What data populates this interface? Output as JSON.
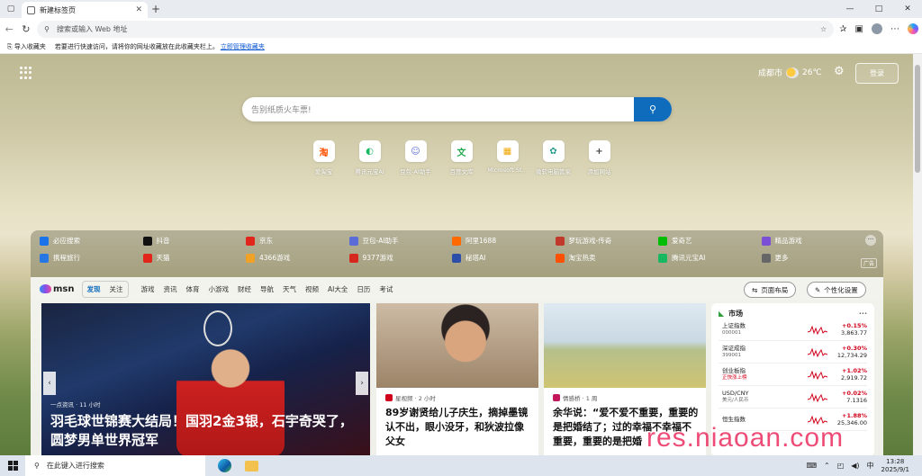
{
  "browser": {
    "tab_title": "新建标签页",
    "new_tab_symbol": "+",
    "address_placeholder": "搜索或输入 Web 地址",
    "window_controls": [
      "—",
      "□",
      "✕"
    ]
  },
  "favorites_bar": {
    "import_label": "导入收藏夹",
    "message": "若要进行快速访问，请将你的网址收藏放在此收藏夹栏上。",
    "manage_link": "立即管理收藏夹"
  },
  "header": {
    "city": "成都市",
    "temperature": "26℃",
    "login_label": "登录"
  },
  "search": {
    "placeholder": "告别纸质火车票!"
  },
  "quick_links": [
    {
      "label": "爱淘宝",
      "icon": "taobao-icon",
      "glyph": "淘",
      "color": "#ff5000"
    },
    {
      "label": "腾讯元宝AI",
      "icon": "yuanbao-icon",
      "glyph": "◐",
      "color": "#17b860"
    },
    {
      "label": "豆包-AI助手",
      "icon": "doubao-icon",
      "glyph": "☺",
      "color": "#5a6cd8"
    },
    {
      "label": "百度文库",
      "icon": "wenku-icon",
      "glyph": "文",
      "color": "#22a94e"
    },
    {
      "label": "Microsoft St...",
      "icon": "store-icon",
      "glyph": "▦",
      "color": "#f0a500"
    },
    {
      "label": "微软电脑管家",
      "icon": "pc-manager-icon",
      "glyph": "✿",
      "color": "#2a9d8f"
    },
    {
      "label": "添加网站",
      "icon": "add-icon",
      "glyph": "+",
      "color": "#444444"
    }
  ],
  "site_links": {
    "row1": [
      {
        "label": "必应搜索",
        "color": "#1a73e8"
      },
      {
        "label": "抖音",
        "color": "#111111"
      },
      {
        "label": "京东",
        "color": "#e1251b"
      },
      {
        "label": "豆包-AI助手",
        "color": "#5a6cd8"
      },
      {
        "label": "阿里1688",
        "color": "#ff6a00"
      },
      {
        "label": "梦玩游戏-传奇",
        "color": "#c0392b"
      },
      {
        "label": "爱奇艺",
        "color": "#00be06"
      },
      {
        "label": "精品游戏",
        "color": "#7b4fd6"
      }
    ],
    "row2": [
      {
        "label": "携程旅行",
        "color": "#2577e3"
      },
      {
        "label": "天猫",
        "color": "#e1251b"
      },
      {
        "label": "4366游戏",
        "color": "#f2a127"
      },
      {
        "label": "9377游戏",
        "color": "#d6281e"
      },
      {
        "label": "秘塔AI",
        "color": "#2d4ea8"
      },
      {
        "label": "淘宝热卖",
        "color": "#ff5000"
      },
      {
        "label": "腾讯元宝AI",
        "color": "#17b860"
      },
      {
        "label": "更多",
        "color": "#666666"
      }
    ],
    "more_dots": "···",
    "ad_label": "广告"
  },
  "feed": {
    "brand": "msn",
    "tabs_active_group": [
      "发现",
      "关注"
    ],
    "tabs": [
      "游戏",
      "资讯",
      "体育",
      "小游戏",
      "财经",
      "导航",
      "天气",
      "视频",
      "AI大全",
      "日历",
      "考试"
    ],
    "layout_button": "页面布局",
    "personalize_button": "个性化设置"
  },
  "cards": [
    {
      "source": "一点资讯 · 11 小时",
      "title": "羽毛球世锦赛大结局！国羽2金3银，石宇奇哭了，圆梦男单世界冠军"
    },
    {
      "source": "星视频 · 2 小时",
      "title": "89岁谢贤给儿子庆生，摘掉墨镜认不出，眼小没牙，和狄波拉像父女"
    },
    {
      "source": "情感桥 · 1 周",
      "title": "余华说：“爱不爱不重要，重要的是把婚结了；过的幸福不幸福不重要，重要的是把婚"
    }
  ],
  "market": {
    "title": "市场",
    "rows": [
      {
        "name": "上证指数",
        "code": "000001",
        "change": "+0.15%",
        "value": "3,863.77"
      },
      {
        "name": "深证成指",
        "code": "399001",
        "change": "+0.30%",
        "value": "12,734.29"
      },
      {
        "name": "创业板指",
        "code": "正快涨上榜",
        "change": "+1.02%",
        "value": "2,919.72"
      },
      {
        "name": "USD/CNY",
        "code": "美元/人民币",
        "change": "+0.02%",
        "value": "7.1316"
      },
      {
        "name": "恒生指数",
        "code": "",
        "change": "+1.88%",
        "value": "25,346.00"
      }
    ]
  },
  "watermark": "res.niaoan.com",
  "taskbar": {
    "search_placeholder": "在此键入进行搜索",
    "ime": "中",
    "time": "13:28",
    "date": "2025/9/1"
  }
}
